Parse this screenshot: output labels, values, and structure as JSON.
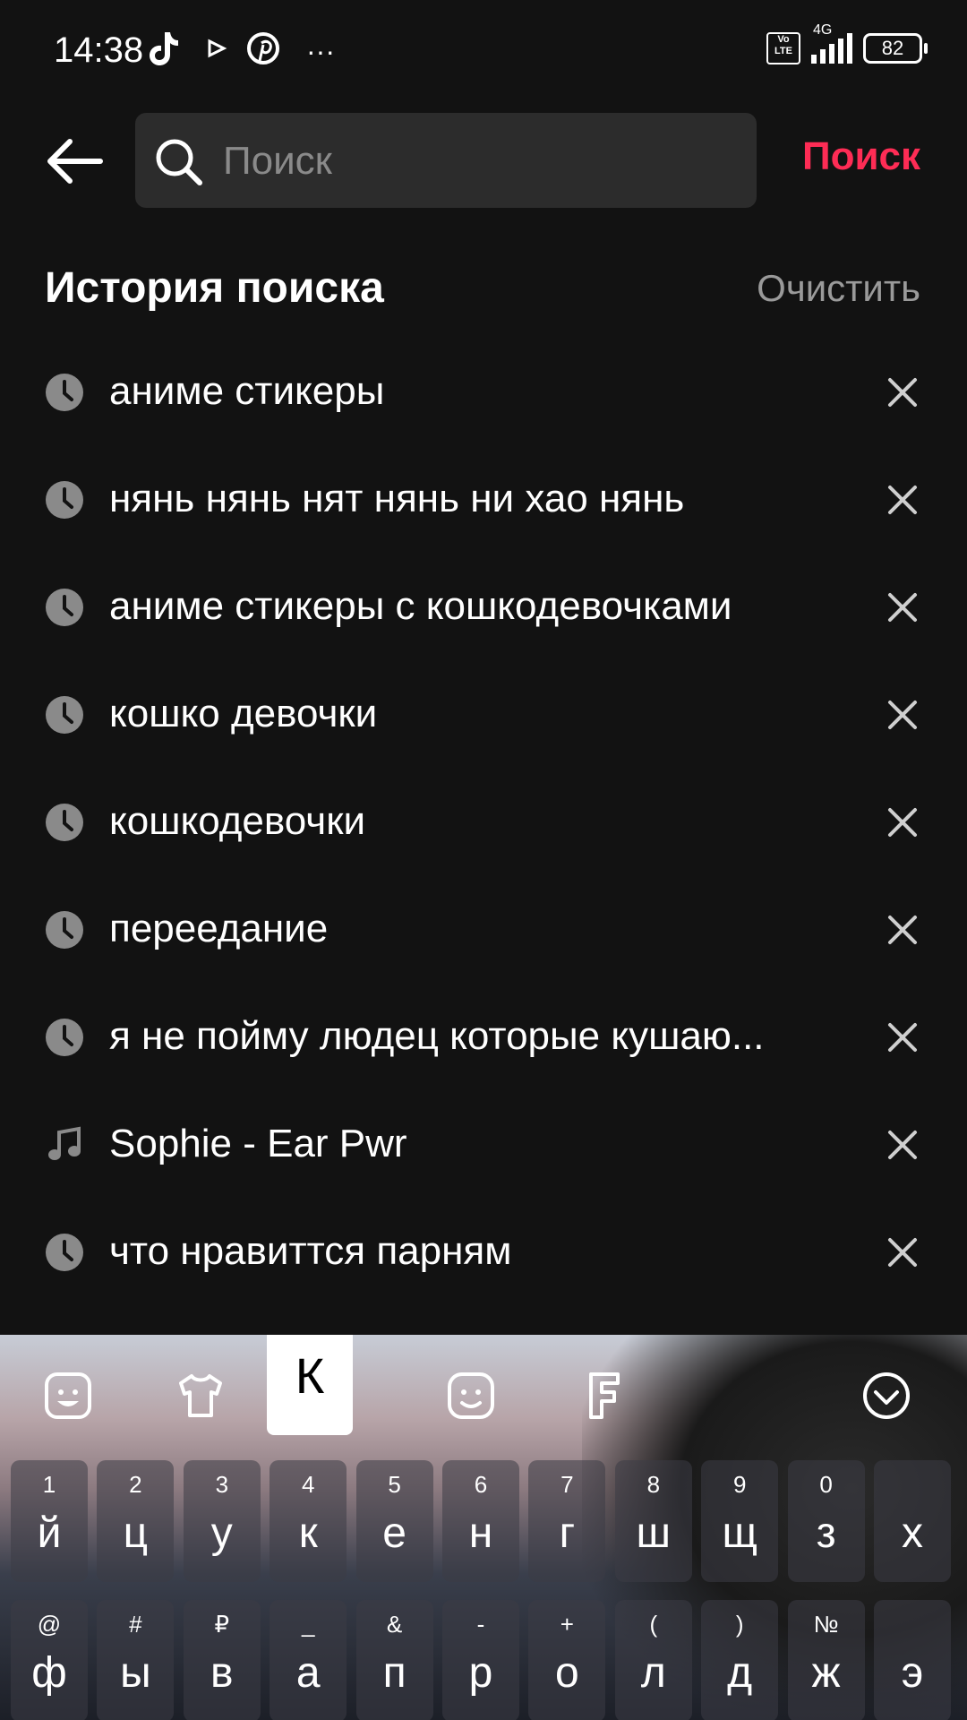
{
  "status_bar": {
    "time": "14:38",
    "notification_icons": [
      "tiktok-icon",
      "play-icon",
      "pinterest-icon",
      "more-dots-icon"
    ],
    "more_dots": "···",
    "network": "4G",
    "volte": "Vo LTE",
    "battery": "82"
  },
  "header": {
    "search_placeholder": "Поиск",
    "search_value": "",
    "submit_label": "Поиск",
    "accent_color": "#fe2c55"
  },
  "history": {
    "title": "История поиска",
    "clear_label": "Очистить",
    "items": [
      {
        "text": "аниме стикеры",
        "icon": "clock-icon"
      },
      {
        "text": "нянь нянь нят нянь ни хао нянь",
        "icon": "clock-icon"
      },
      {
        "text": "аниме стикеры с кошкодевочками",
        "icon": "clock-icon"
      },
      {
        "text": "кошко девочки",
        "icon": "clock-icon"
      },
      {
        "text": "кошкодевочки",
        "icon": "clock-icon"
      },
      {
        "text": "переедание",
        "icon": "clock-icon"
      },
      {
        "text": "я не пойму людец которые кушаю...",
        "icon": "clock-icon"
      },
      {
        "text": "Sophie - Ear Pwr",
        "icon": "music-note-icon"
      },
      {
        "text": "что нравиттся парням",
        "icon": "clock-icon"
      }
    ]
  },
  "keyboard": {
    "preview_key": "К",
    "toolbar_icons": [
      "emoji-icon",
      "theme-shirt-icon",
      "sticker-icon",
      "font-icon",
      "collapse-chevron-icon"
    ],
    "row1": [
      {
        "char": "й",
        "hint": "1"
      },
      {
        "char": "ц",
        "hint": "2"
      },
      {
        "char": "у",
        "hint": "3"
      },
      {
        "char": "к",
        "hint": "4"
      },
      {
        "char": "е",
        "hint": "5"
      },
      {
        "char": "н",
        "hint": "6"
      },
      {
        "char": "г",
        "hint": "7"
      },
      {
        "char": "ш",
        "hint": "8"
      },
      {
        "char": "щ",
        "hint": "9"
      },
      {
        "char": "з",
        "hint": "0"
      },
      {
        "char": "х",
        "hint": ""
      }
    ],
    "row2": [
      {
        "char": "ф",
        "hint": "@"
      },
      {
        "char": "ы",
        "hint": "#"
      },
      {
        "char": "в",
        "hint": "₽"
      },
      {
        "char": "а",
        "hint": "_"
      },
      {
        "char": "п",
        "hint": "&"
      },
      {
        "char": "р",
        "hint": "-"
      },
      {
        "char": "о",
        "hint": "+"
      },
      {
        "char": "л",
        "hint": "("
      },
      {
        "char": "д",
        "hint": ")"
      },
      {
        "char": "ж",
        "hint": "№"
      },
      {
        "char": "э",
        "hint": ""
      }
    ]
  }
}
